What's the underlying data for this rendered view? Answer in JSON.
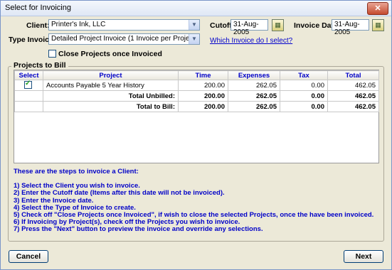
{
  "window": {
    "title": "Select for Invoicing",
    "close_label": "✕"
  },
  "form": {
    "client_label": "Client:",
    "client_value": "Printer's Ink, LLC",
    "cutoff_label": "Cutoff:",
    "cutoff_value": "31-Aug-2005",
    "invoice_date_label": "Invoice Date:",
    "invoice_date_value": "31-Aug-2005",
    "type_label": "Type Invoice:",
    "type_value": "Detailed Project Invoice (1 Invoice per Project)",
    "which_link": "Which Invoice do I select?",
    "close_projects_label": "Close Projects once Invoiced",
    "close_projects_checked": false
  },
  "projects": {
    "group_label": "Projects to Bill",
    "columns": [
      "Select",
      "Project",
      "Time",
      "Expenses",
      "Tax",
      "Total"
    ],
    "rows": [
      {
        "selected": true,
        "project": "Accounts Payable 5 Year History",
        "time": "200.00",
        "expenses": "262.05",
        "tax": "0.00",
        "total": "462.05"
      }
    ],
    "total_unbilled": {
      "label": "Total Unbilled:",
      "time": "200.00",
      "expenses": "262.05",
      "tax": "0.00",
      "total": "462.05"
    },
    "total_to_bill": {
      "label": "Total to Bill:",
      "time": "200.00",
      "expenses": "262.05",
      "tax": "0.00",
      "total": "462.05"
    }
  },
  "steps": {
    "heading": "These are the steps to invoice a Client:",
    "items": [
      "1) Select the Client you wish to invoice.",
      "2) Enter the Cutoff date (Items after this date will not be invoiced).",
      "3) Enter the Invoice date.",
      "4) Select the Type of Invoice to create.",
      "5) Check off \"Close Projects once Invoiced\", if wish to close the selected Projects, once the have been invoiced.",
      "6) If Invoicing by Project(s), check off the Projects you wish to invoice.",
      "7) Press the \"Next\" button to preview the invoice and override any selections."
    ]
  },
  "buttons": {
    "cancel": "Cancel",
    "next": "Next"
  },
  "icons": {
    "dropdown": "chevron-down-icon",
    "calendar": "calendar-icon",
    "checkbox": "checkmark-icon",
    "close": "close-icon"
  }
}
